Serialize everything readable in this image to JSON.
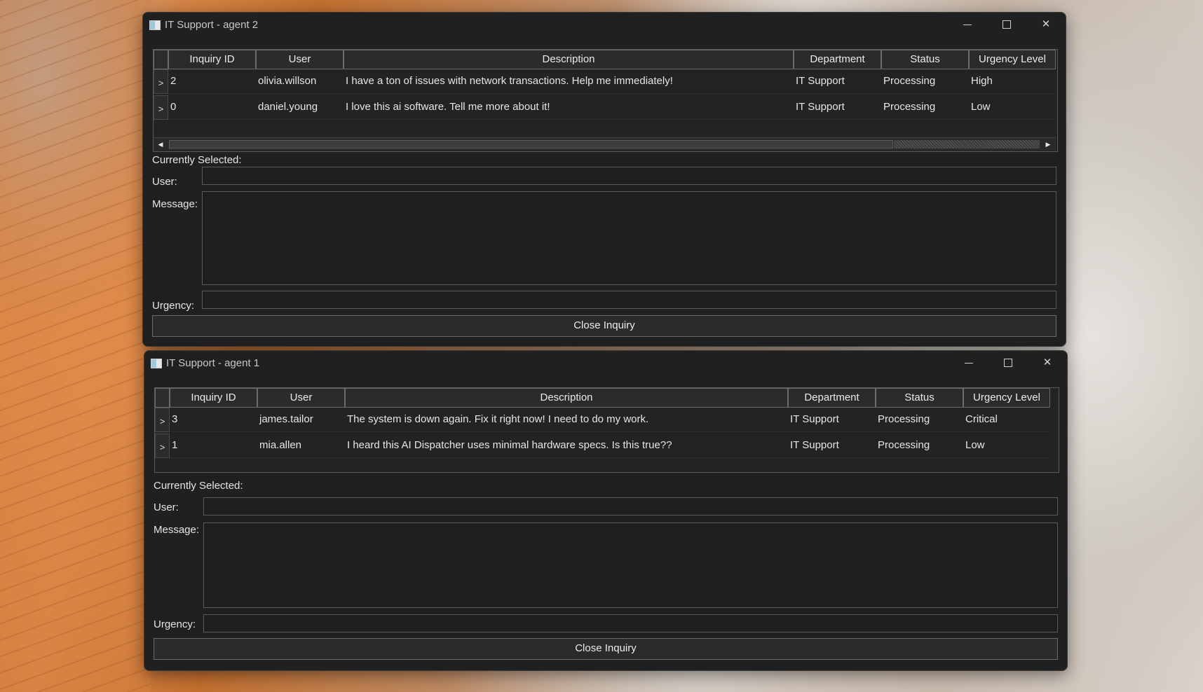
{
  "windows": [
    {
      "title": "IT Support - agent 2",
      "columns": [
        "Inquiry ID",
        "User",
        "Description",
        "Department",
        "Status",
        "Urgency Level"
      ],
      "row_marker": ">",
      "rows": [
        {
          "id": "2",
          "user": "olivia.willson",
          "description": "I have a ton of issues with network transactions. Help me immediately!",
          "department": "IT Support",
          "status": "Processing",
          "urgency": "High"
        },
        {
          "id": "0",
          "user": "daniel.young",
          "description": "I love this ai software. Tell me more about it!",
          "department": "IT Support",
          "status": "Processing",
          "urgency": "Low"
        }
      ],
      "scroll_left_glyph": "◀",
      "scroll_right_glyph": "▶",
      "currently_selected_label": "Currently Selected:",
      "user_label": "User:",
      "message_label": "Message:",
      "urgency_label": "Urgency:",
      "user_value": "",
      "message_value": "",
      "urgency_value": "",
      "close_button_label": "Close Inquiry"
    },
    {
      "title": "IT Support - agent 1",
      "columns": [
        "Inquiry ID",
        "User",
        "Description",
        "Department",
        "Status",
        "Urgency Level"
      ],
      "row_marker": ">",
      "rows": [
        {
          "id": "3",
          "user": "james.tailor",
          "description": "The system is down again. Fix it right now! I need to do my work.",
          "department": "IT Support",
          "status": "Processing",
          "urgency": "Critical"
        },
        {
          "id": "1",
          "user": "mia.allen",
          "description": "I heard this AI Dispatcher uses minimal hardware specs. Is this true??",
          "department": "IT Support",
          "status": "Processing",
          "urgency": "Low"
        }
      ],
      "currently_selected_label": "Currently Selected:",
      "user_label": "User:",
      "message_label": "Message:",
      "urgency_label": "Urgency:",
      "user_value": "",
      "message_value": "",
      "urgency_value": "",
      "close_button_label": "Close Inquiry"
    }
  ],
  "icons": {
    "window_icon": "app-window-icon",
    "minimize": "minimize-icon",
    "maximize": "maximize-icon",
    "close": "close-icon"
  },
  "colors": {
    "window_bg": "#202020",
    "header_bg": "#2b2b2b",
    "text": "#e6e6e6"
  }
}
